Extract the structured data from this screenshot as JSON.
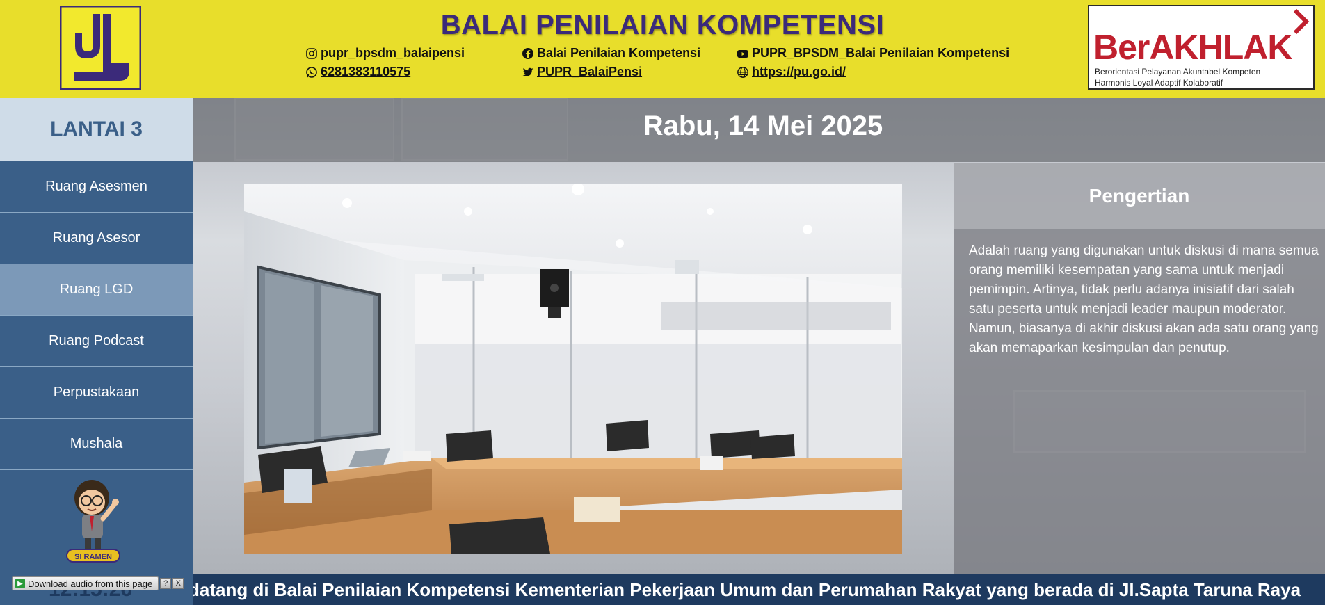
{
  "header": {
    "title": "BALAI PENILAIAN KOMPETENSI",
    "socials": [
      {
        "icon": "instagram-icon",
        "label": "pupr_bpsdm_balaipensi"
      },
      {
        "icon": "whatsapp-icon",
        "label": "6281383110575"
      },
      {
        "icon": "facebook-icon",
        "label": "Balai Penilaian Kompetensi"
      },
      {
        "icon": "twitter-icon",
        "label": "PUPR_BalaiPensi"
      },
      {
        "icon": "youtube-icon",
        "label": "PUPR_BPSDM_Balai Penilaian Kompetensi"
      },
      {
        "icon": "globe-icon",
        "label": "https://pu.go.id/"
      }
    ],
    "berakhlak": {
      "title": "BerAKHLAK",
      "line1": "Berorientasi Pelayanan Akuntabel Kompeten",
      "line2": "Harmonis Loyal Adaptif Kolaboratif"
    }
  },
  "sidebar": {
    "floor": "LANTAI 3",
    "items": [
      {
        "label": "Ruang Asesmen"
      },
      {
        "label": "Ruang Asesor"
      },
      {
        "label": "Ruang LGD"
      },
      {
        "label": "Ruang Podcast"
      },
      {
        "label": "Perpustakaan"
      },
      {
        "label": "Mushala"
      },
      {
        "label": ""
      }
    ],
    "active_index": 2,
    "mascot_text": "SI RAMEN"
  },
  "main": {
    "date": "Rabu, 14 Mei 2025",
    "info_title": "Pengertian",
    "info_text": "Adalah ruang yang digunakan untuk diskusi di mana semua orang memiliki kesempatan yang sama untuk menjadi pemimpin. Artinya, tidak perlu adanya inisiatif dari salah satu peserta untuk menjadi leader maupun moderator. Namun, biasanya di akhir diskusi akan ada satu orang yang akan memaparkan kesimpulan dan penutup."
  },
  "footer": {
    "clock": "12:15:26",
    "ticker": "datang di Balai Penilaian Kompetensi Kementerian Pekerjaan Umum dan Perumahan Rakyat yang berada di Jl.Sapta Taruna Raya"
  },
  "download_bar": {
    "label": "Download audio from this page",
    "help": "?",
    "close": "X"
  },
  "colors": {
    "header_bg": "#e8de2b",
    "title": "#3b2a7a",
    "sidebar": "#3a5f88",
    "sidebar_active": "#7c99b8",
    "berakhlak_red": "#c0202e"
  }
}
